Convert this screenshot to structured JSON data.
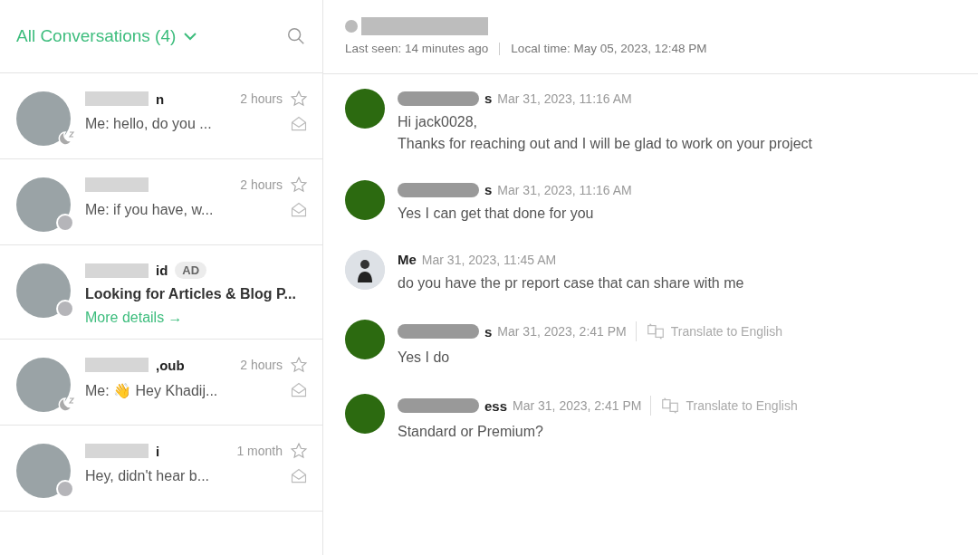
{
  "sidebar": {
    "title": "All Conversations (4)",
    "conversations": [
      {
        "kind": "chat",
        "name": "n",
        "time": "2 hours",
        "preview": "Me: hello, do you ...",
        "away": true,
        "starred": false
      },
      {
        "kind": "chat",
        "time": "2 hours",
        "preview": "Me: if you have, w...",
        "away": false,
        "starred": false
      },
      {
        "kind": "ad",
        "name": "id",
        "badge": "AD",
        "preview": "Looking for Articles & Blog P...",
        "link": "More details →",
        "away": false
      },
      {
        "kind": "chat",
        "name": ",oub",
        "time": "2 hours",
        "preview": "Me: 👋 Hey Khadij...",
        "away": true,
        "starred": false
      },
      {
        "kind": "chat",
        "name": "i",
        "time": "1 month",
        "preview": "Hey, didn't hear b...",
        "away": false,
        "starred": false
      }
    ]
  },
  "chat": {
    "contact": {
      "online": false,
      "last_seen": "Last seen: 14 minutes ago",
      "local_time": "Local time: May 05, 2023, 12:48 PM"
    },
    "messages": [
      {
        "own": false,
        "sender": "s",
        "time": "Mar 31, 2023, 11:16 AM",
        "lines": [
          "Hi jack0028,",
          "Thanks for reaching out and I will be glad to work on your project"
        ]
      },
      {
        "own": false,
        "sender": "s",
        "time": "Mar 31, 2023, 11:16 AM",
        "lines": [
          "Yes I can get that done for you"
        ]
      },
      {
        "own": true,
        "sender": "Me",
        "time": "Mar 31, 2023, 11:45 AM",
        "lines": [
          "do you have the pr report case that can share with me"
        ]
      },
      {
        "own": false,
        "sender": "s",
        "time": "Mar 31, 2023, 2:41 PM",
        "translate": "Translate to English",
        "lines": [
          "Yes I do"
        ]
      },
      {
        "own": false,
        "sender": "ess",
        "time": "Mar 31, 2023, 2:41 PM",
        "translate": "Translate to English",
        "lines": [
          "Standard or Premium?"
        ]
      }
    ]
  }
}
